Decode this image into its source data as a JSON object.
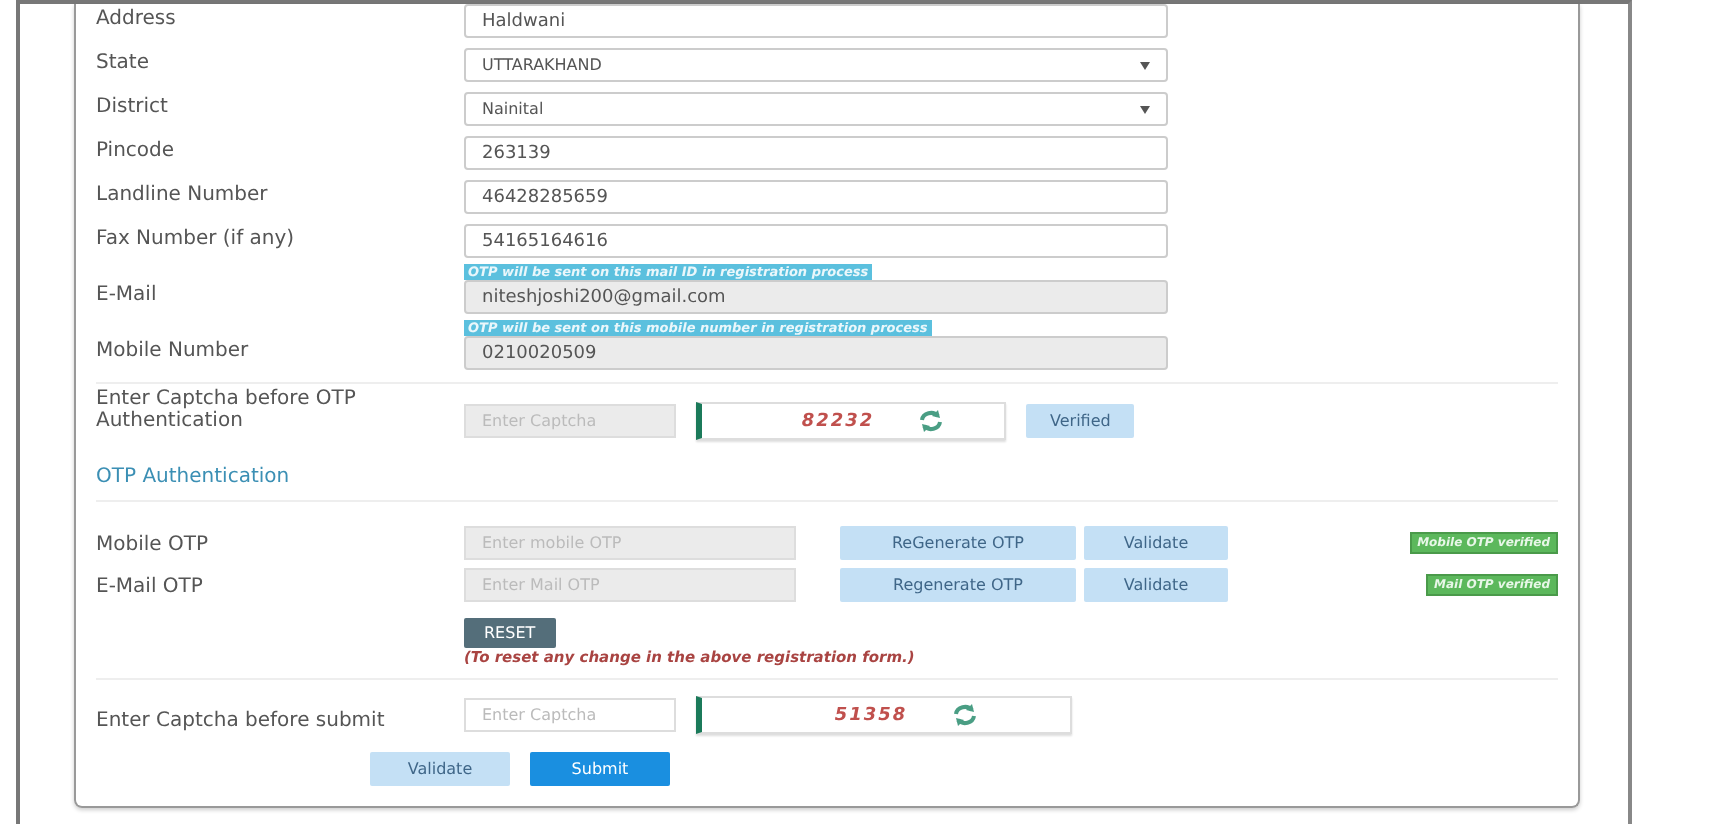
{
  "fields": [
    {
      "label": "Address",
      "kind": "text",
      "value": "Haldwani",
      "disabled": false
    },
    {
      "label": "State",
      "kind": "select",
      "value": "UTTARAKHAND",
      "disabled": false
    },
    {
      "label": "District",
      "kind": "select",
      "value": "Nainital",
      "disabled": false
    },
    {
      "label": "Pincode",
      "kind": "text",
      "value": "263139",
      "disabled": false
    },
    {
      "label": "Landline Number",
      "kind": "text",
      "value": "46428285659",
      "disabled": false
    },
    {
      "label": "Fax Number (if any)",
      "kind": "text",
      "value": "54165164616",
      "disabled": false
    },
    {
      "label": "E-Mail",
      "kind": "text",
      "hint": "OTP will be sent on this mail ID in registration process",
      "value": "niteshjoshi200@gmail.com",
      "disabled": true
    },
    {
      "label": "Mobile Number",
      "kind": "text",
      "hint": "OTP will be sent on this mobile number in registration process",
      "value": "0210020509",
      "disabled": true
    }
  ],
  "captcha_otp": {
    "label": "Enter Captcha before OTP Authentication",
    "placeholder": "Enter Captcha",
    "disabled": true,
    "code": "82232",
    "button": {
      "label": "Verified",
      "disabled": true
    }
  },
  "otp_section": {
    "title": "OTP Authentication"
  },
  "otp_rows": [
    {
      "label": "Mobile OTP",
      "placeholder": "Enter mobile OTP",
      "disabled": true,
      "regenerate": {
        "label": "ReGenerate OTP",
        "disabled": true
      },
      "validate": {
        "label": "Validate",
        "disabled": true
      },
      "badge": "Mobile OTP verified"
    },
    {
      "label": "E-Mail OTP",
      "placeholder": "Enter Mail OTP",
      "disabled": true,
      "regenerate": {
        "label": "Regenerate OTP",
        "disabled": true
      },
      "validate": {
        "label": "Validate",
        "disabled": true
      },
      "badge": "Mail OTP verified"
    }
  ],
  "reset": {
    "label": "RESET",
    "note": "(To reset any change in the above registration form.)"
  },
  "captcha_submit": {
    "label": "Enter Captcha before submit",
    "placeholder": "Enter Captcha",
    "disabled": false,
    "code": "51358"
  },
  "actions": [
    {
      "label": "Validate",
      "disabled": true
    },
    {
      "label": "Submit",
      "disabled": false
    }
  ]
}
